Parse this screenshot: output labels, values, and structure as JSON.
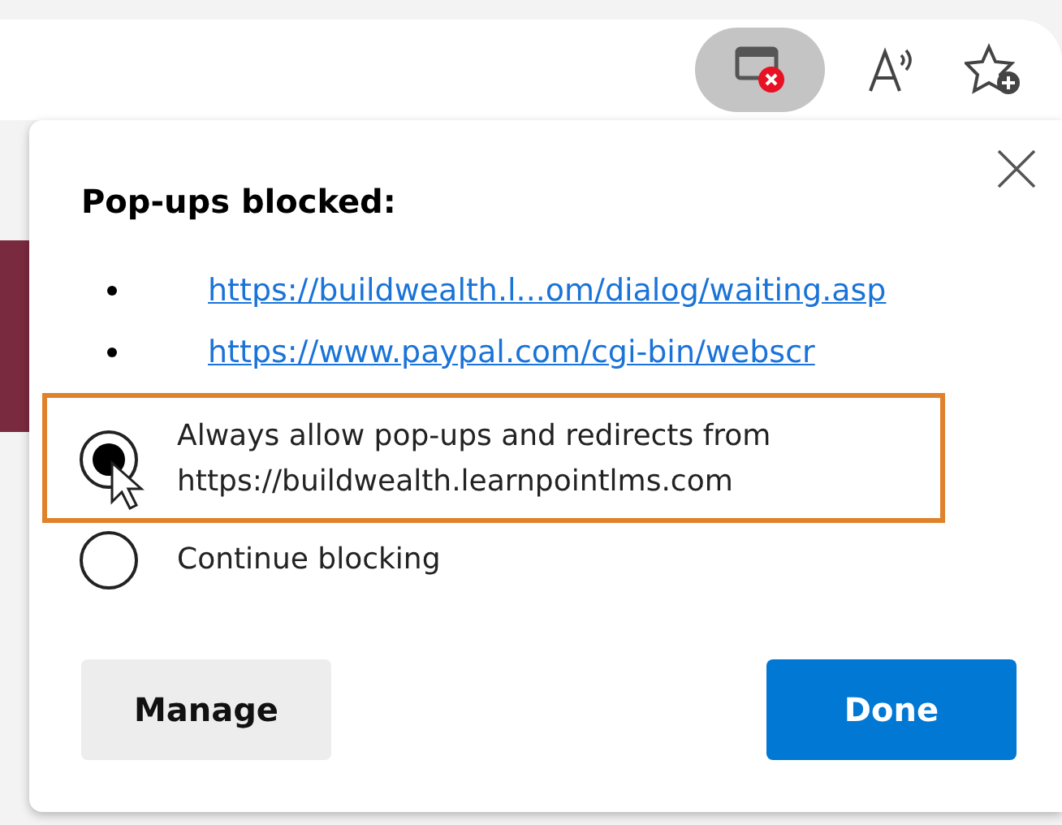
{
  "popup": {
    "title": "Pop-ups blocked:",
    "blocked_links": [
      "https://buildwealth.l...om/dialog/waiting.asp",
      "https://www.paypal.com/cgi-bin/webscr"
    ],
    "options": [
      {
        "label": "Always allow pop-ups and redirects from",
        "detail": "https://buildwealth.learnpointlms.com",
        "selected": true,
        "highlighted": true
      },
      {
        "label": "Continue blocking",
        "selected": false,
        "highlighted": false
      }
    ],
    "buttons": [
      {
        "label": "Manage",
        "kind": "secondary"
      },
      {
        "label": "Done",
        "kind": "primary"
      }
    ]
  }
}
